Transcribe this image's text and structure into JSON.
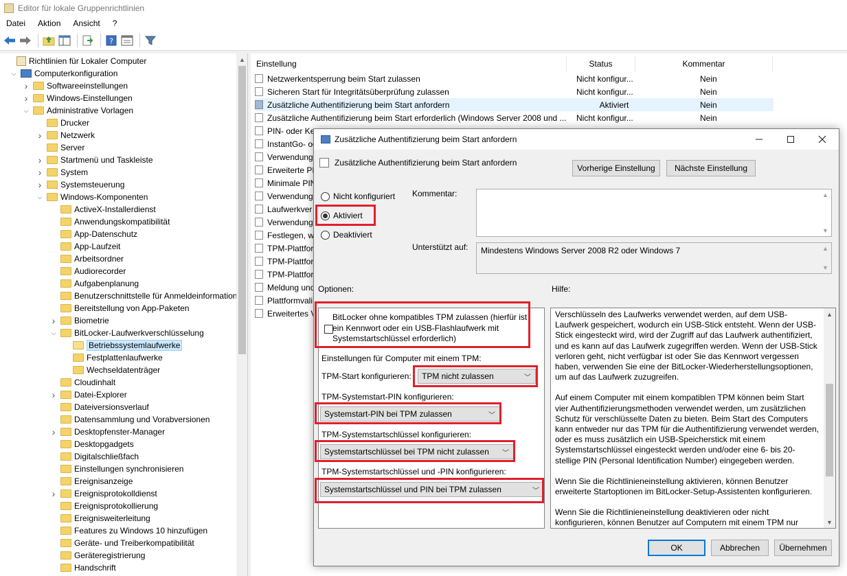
{
  "window": {
    "title": "Editor für lokale Gruppenrichtlinien"
  },
  "menu": [
    "Datei",
    "Aktion",
    "Ansicht",
    "?"
  ],
  "toolbar": {
    "icons": [
      "back-arrow-icon",
      "forward-arrow-icon",
      "up-folder-icon",
      "show-hide-tree-icon",
      "export-list-icon",
      "help-icon",
      "properties-icon",
      "filter-icon"
    ]
  },
  "tree": {
    "items": [
      {
        "label": "Richtlinien für Lokaler Computer",
        "level": 0,
        "exp": "",
        "icon": "doc"
      },
      {
        "label": "Computerkonfiguration",
        "level": 1,
        "exp": "open",
        "icon": "pc"
      },
      {
        "label": "Softwareeinstellungen",
        "level": 2,
        "exp": "closed",
        "icon": "folder"
      },
      {
        "label": "Windows-Einstellungen",
        "level": 2,
        "exp": "closed",
        "icon": "folder"
      },
      {
        "label": "Administrative Vorlagen",
        "level": 2,
        "exp": "open",
        "icon": "folder"
      },
      {
        "label": "Drucker",
        "level": 3,
        "exp": "",
        "icon": "folder"
      },
      {
        "label": "Netzwerk",
        "level": 3,
        "exp": "closed",
        "icon": "folder"
      },
      {
        "label": "Server",
        "level": 3,
        "exp": "",
        "icon": "folder"
      },
      {
        "label": "Startmenü und Taskleiste",
        "level": 3,
        "exp": "closed",
        "icon": "folder"
      },
      {
        "label": "System",
        "level": 3,
        "exp": "closed",
        "icon": "folder"
      },
      {
        "label": "Systemsteuerung",
        "level": 3,
        "exp": "closed",
        "icon": "folder"
      },
      {
        "label": "Windows-Komponenten",
        "level": 3,
        "exp": "open",
        "icon": "folder"
      },
      {
        "label": "ActiveX-Installerdienst",
        "level": 4,
        "exp": "",
        "icon": "folder"
      },
      {
        "label": "Anwendungskompatibilität",
        "level": 4,
        "exp": "",
        "icon": "folder"
      },
      {
        "label": "App-Datenschutz",
        "level": 4,
        "exp": "",
        "icon": "folder"
      },
      {
        "label": "App-Laufzeit",
        "level": 4,
        "exp": "",
        "icon": "folder"
      },
      {
        "label": "Arbeitsordner",
        "level": 4,
        "exp": "",
        "icon": "folder"
      },
      {
        "label": "Audiorecorder",
        "level": 4,
        "exp": "",
        "icon": "folder"
      },
      {
        "label": "Aufgabenplanung",
        "level": 4,
        "exp": "",
        "icon": "folder"
      },
      {
        "label": "Benutzerschnittstelle für Anmeldeinformation",
        "level": 4,
        "exp": "",
        "icon": "folder"
      },
      {
        "label": "Bereitstellung von App-Paketen",
        "level": 4,
        "exp": "",
        "icon": "folder"
      },
      {
        "label": "Biometrie",
        "level": 4,
        "exp": "closed",
        "icon": "folder"
      },
      {
        "label": "BitLocker-Laufwerkverschlüsselung",
        "level": 4,
        "exp": "open",
        "icon": "folder"
      },
      {
        "label": "Betriebssystemlaufwerke",
        "level": 5,
        "exp": "",
        "icon": "folder-open",
        "selected": true
      },
      {
        "label": "Festplattenlaufwerke",
        "level": 5,
        "exp": "",
        "icon": "folder"
      },
      {
        "label": "Wechseldatenträger",
        "level": 5,
        "exp": "",
        "icon": "folder"
      },
      {
        "label": "Cloudinhalt",
        "level": 4,
        "exp": "",
        "icon": "folder"
      },
      {
        "label": "Datei-Explorer",
        "level": 4,
        "exp": "closed",
        "icon": "folder"
      },
      {
        "label": "Dateiversionsverlauf",
        "level": 4,
        "exp": "",
        "icon": "folder"
      },
      {
        "label": "Datensammlung und Vorabversionen",
        "level": 4,
        "exp": "",
        "icon": "folder"
      },
      {
        "label": "Desktopfenster-Manager",
        "level": 4,
        "exp": "closed",
        "icon": "folder"
      },
      {
        "label": "Desktopgadgets",
        "level": 4,
        "exp": "",
        "icon": "folder"
      },
      {
        "label": "Digitalschließfach",
        "level": 4,
        "exp": "",
        "icon": "folder"
      },
      {
        "label": "Einstellungen synchronisieren",
        "level": 4,
        "exp": "",
        "icon": "folder"
      },
      {
        "label": "Ereignisanzeige",
        "level": 4,
        "exp": "",
        "icon": "folder"
      },
      {
        "label": "Ereignisprotokolldienst",
        "level": 4,
        "exp": "closed",
        "icon": "folder"
      },
      {
        "label": "Ereignisprotokollierung",
        "level": 4,
        "exp": "",
        "icon": "folder"
      },
      {
        "label": "Ereignisweiterleitung",
        "level": 4,
        "exp": "",
        "icon": "folder"
      },
      {
        "label": "Features zu Windows 10 hinzufügen",
        "level": 4,
        "exp": "",
        "icon": "folder"
      },
      {
        "label": "Geräte- und Treiberkompatibilität",
        "level": 4,
        "exp": "",
        "icon": "folder"
      },
      {
        "label": "Geräteregistrierung",
        "level": 4,
        "exp": "",
        "icon": "folder"
      },
      {
        "label": "Handschrift",
        "level": 4,
        "exp": "",
        "icon": "folder"
      }
    ]
  },
  "list": {
    "columns": {
      "setting": "Einstellung",
      "status": "Status",
      "comment": "Kommentar"
    },
    "rows": [
      {
        "name": "Netzwerkentsperrung beim Start zulassen",
        "status": "Nicht konfigur...",
        "comment": "Nein"
      },
      {
        "name": "Sicheren Start für Integritätsüberprüfung zulassen",
        "status": "Nicht konfigur...",
        "comment": "Nein"
      },
      {
        "name": "Zusätzliche Authentifizierung beim Start anfordern",
        "status": "Aktiviert",
        "comment": "Nein",
        "highlight": true
      },
      {
        "name": "Zusätzliche Authentifizierung beim Start erforderlich (Windows Server 2008 und ...",
        "status": "Nicht konfigur...",
        "comment": "Nein"
      },
      {
        "name": "PIN- oder Ke",
        "status": "",
        "comment": ""
      },
      {
        "name": "InstantGo- od",
        "status": "",
        "comment": ""
      },
      {
        "name": "Verwendung",
        "status": "",
        "comment": ""
      },
      {
        "name": "Erweiterte PIN",
        "status": "",
        "comment": ""
      },
      {
        "name": "Minimale PIN",
        "status": "",
        "comment": ""
      },
      {
        "name": "Verwendung",
        "status": "",
        "comment": ""
      },
      {
        "name": "Laufwerkver",
        "status": "",
        "comment": ""
      },
      {
        "name": "Verwendung",
        "status": "",
        "comment": ""
      },
      {
        "name": "Festlegen, wi",
        "status": "",
        "comment": ""
      },
      {
        "name": "TPM-Plattfor",
        "status": "",
        "comment": ""
      },
      {
        "name": "TPM-Plattfor",
        "status": "",
        "comment": ""
      },
      {
        "name": "TPM-Plattfor",
        "status": "",
        "comment": ""
      },
      {
        "name": "Meldung und",
        "status": "",
        "comment": ""
      },
      {
        "name": "Plattformvali",
        "status": "",
        "comment": ""
      },
      {
        "name": "Erweitertes V",
        "status": "",
        "comment": ""
      }
    ]
  },
  "dialog": {
    "title": "Zusätzliche Authentifizierung beim Start anfordern",
    "subtitle": "Zusätzliche Authentifizierung beim Start anfordern",
    "prev_button": "Vorherige Einstellung",
    "next_button": "Nächste Einstellung",
    "radio_not_configured": "Nicht konfiguriert",
    "radio_enabled": "Aktiviert",
    "radio_disabled": "Deaktiviert",
    "selected_radio": "enabled",
    "comment_label": "Kommentar:",
    "comment_value": "",
    "supported_label": "Unterstützt auf:",
    "supported_value": "Mindestens Windows Server 2008 R2 oder Windows 7",
    "options_label": "Optionen:",
    "help_label": "Hilfe:",
    "options": {
      "bitlocker_checkbox_label": "BitLocker ohne kompatibles TPM zulassen (hierfür ist ein Kennwort oder ein USB-Flashlaufwerk mit Systemstartschlüssel erforderlich)",
      "bitlocker_checked": false,
      "tpm_settings_heading": "Einstellungen für Computer mit einem TPM:",
      "tpm_start_label": "TPM-Start konfigurieren:",
      "tpm_start_value": "TPM nicht zulassen",
      "tpm_pin_label": "TPM-Systemstart-PIN konfigurieren:",
      "tpm_pin_value": "Systemstart-PIN bei TPM zulassen",
      "tpm_key_label": "TPM-Systemstartschlüssel konfigurieren:",
      "tpm_key_value": "Systemstartschlüssel bei TPM nicht zulassen",
      "tpm_key_pin_label": "TPM-Systemstartschlüssel und -PIN konfigurieren:",
      "tpm_key_pin_value": "Systemstartschlüssel und PIN bei TPM zulassen"
    },
    "help_paragraphs": [
      "Verschlüsseln des Laufwerks verwendet werden, auf dem USB-Laufwerk gespeichert, wodurch ein USB-Stick entsteht. Wenn der USB-Stick eingesteckt wird, wird der Zugriff auf das Laufwerk authentifiziert, und es kann auf das Laufwerk zugegriffen werden. Wenn der USB-Stick verloren geht, nicht verfügbar ist oder Sie das Kennwort vergessen haben, verwenden Sie eine der BitLocker-Wiederherstellungsoptionen, um auf das Laufwerk zuzugreifen.",
      "Auf einem Computer mit einem kompatiblen TPM können beim Start vier Authentifizierungsmethoden verwendet werden, um zusätzlichen Schutz für verschlüsselte Daten zu bieten. Beim Start des Computers kann entweder nur das TPM für die Authentifizierung verwendet werden, oder es muss zusätzlich ein USB-Speicherstick mit einem Systemstartschlüssel eingesteckt werden und/oder eine 6- bis 20-stellige PIN (Personal Identification Number) eingegeben werden.",
      "Wenn Sie die Richtlinieneinstellung aktivieren, können Benutzer erweiterte Startoptionen im BitLocker-Setup-Assistenten konfigurieren.",
      "Wenn Sie die Richtlinieneinstellung deaktivieren oder nicht konfigurieren, können Benutzer auf Computern mit einem TPM nur grundlegende"
    ],
    "ok_button": "OK",
    "cancel_button": "Abbrechen",
    "apply_button": "Übernehmen",
    "highlight_color": "#e0202a"
  }
}
